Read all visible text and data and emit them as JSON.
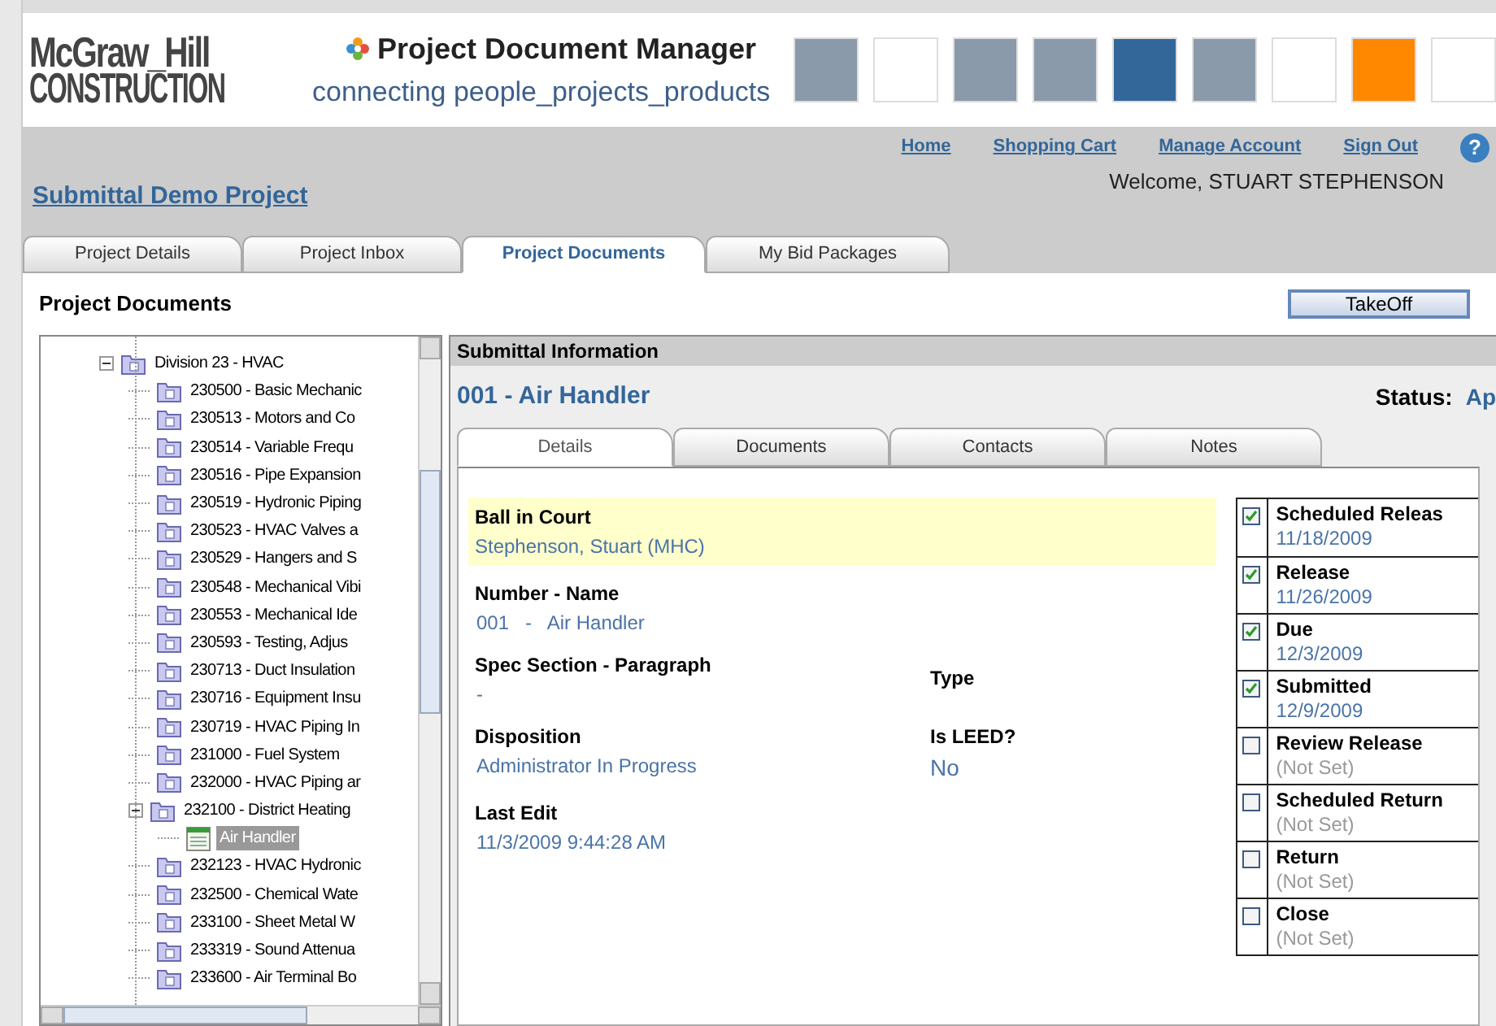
{
  "header": {
    "logo_line1": "McGraw_Hill",
    "logo_line2": "CONSTRUCTION",
    "product": "Project Document Manager",
    "tagline": "connecting people_projects_products",
    "tiles": [
      {
        "kind": "photo"
      },
      {
        "kind": "solid",
        "color": "#ffffff"
      },
      {
        "kind": "photo"
      },
      {
        "kind": "photo"
      },
      {
        "kind": "solid",
        "color": "#336699"
      },
      {
        "kind": "photo"
      },
      {
        "kind": "solid",
        "color": "#ffffff"
      },
      {
        "kind": "solid",
        "color": "#ff8800"
      },
      {
        "kind": "solid",
        "color": "#ffffff"
      }
    ]
  },
  "nav_links": [
    "Home",
    "Shopping Cart",
    "Manage Account",
    "Sign Out"
  ],
  "help": "?",
  "welcome": "Welcome, STUART STEPHENSON",
  "project_title": "Submittal Demo Project",
  "tabs": [
    {
      "label": "Project Details",
      "selected": false
    },
    {
      "label": "Project Inbox",
      "selected": false
    },
    {
      "label": "Project Documents",
      "selected": true
    },
    {
      "label": "My Bid Packages",
      "selected": false
    }
  ],
  "page_title": "Project Documents",
  "takeoff_button": "TakeOff",
  "tree": [
    {
      "label": "Division 23 - HVAC",
      "kind": "folder",
      "expanded": true,
      "selected": false,
      "children": [
        {
          "label": "230500 - Basic Mechanic",
          "kind": "folder",
          "selected": false
        },
        {
          "label": "230513 - Motors and Co",
          "kind": "folder",
          "selected": false
        },
        {
          "label": "230514 - Variable Frequ",
          "kind": "folder",
          "selected": false
        },
        {
          "label": "230516 - Pipe Expansion",
          "kind": "folder",
          "selected": false
        },
        {
          "label": "230519 - Hydronic Piping",
          "kind": "folder",
          "selected": false
        },
        {
          "label": "230523 - HVAC Valves a",
          "kind": "folder",
          "selected": false
        },
        {
          "label": "230529 - Hangers and S",
          "kind": "folder",
          "selected": false
        },
        {
          "label": "230548 - Mechanical Vibi",
          "kind": "folder",
          "selected": false
        },
        {
          "label": "230553 - Mechanical Ide",
          "kind": "folder",
          "selected": false
        },
        {
          "label": "230593 - Testing, Adjus",
          "kind": "folder",
          "selected": false
        },
        {
          "label": "230713 - Duct Insulation",
          "kind": "folder",
          "selected": false
        },
        {
          "label": "230716 - Equipment Insu",
          "kind": "folder",
          "selected": false
        },
        {
          "label": "230719 - HVAC Piping In",
          "kind": "folder",
          "selected": false
        },
        {
          "label": "231000 - Fuel System",
          "kind": "folder",
          "selected": false
        },
        {
          "label": "232000 - HVAC Piping ar",
          "kind": "folder",
          "selected": false
        },
        {
          "label": "232100 - District Heating",
          "kind": "folder",
          "expanded": true,
          "selected": false,
          "children": [
            {
              "label": "Air Handler",
              "kind": "document",
              "selected": true
            }
          ]
        },
        {
          "label": "232123 - HVAC Hydronic",
          "kind": "folder",
          "selected": false
        },
        {
          "label": "232500 - Chemical Wate",
          "kind": "folder",
          "selected": false
        },
        {
          "label": "233100 - Sheet Metal W",
          "kind": "folder",
          "selected": false
        },
        {
          "label": "233319 - Sound Attenua",
          "kind": "folder",
          "selected": false
        },
        {
          "label": "233600 - Air Terminal Bo",
          "kind": "folder",
          "selected": false
        }
      ]
    }
  ],
  "submittal": {
    "header": "Submittal Information",
    "title": "001 - Air Handler",
    "status_label": "Status:",
    "status_value": "Ap",
    "tabs": [
      {
        "label": "Details",
        "selected": true
      },
      {
        "label": "Documents",
        "selected": false
      },
      {
        "label": "Contacts",
        "selected": false
      },
      {
        "label": "Notes",
        "selected": false
      }
    ],
    "ball_in_court": {
      "label": "Ball in Court",
      "value": "Stephenson, Stuart (MHC)",
      "highlighted": true
    },
    "rows": [
      {
        "left": {
          "label": "Number - Name",
          "value": "001   -   Air Handler"
        }
      },
      {
        "left": {
          "label": "Spec Section - Paragraph",
          "value": "-"
        },
        "right": {
          "label": "Type"
        }
      },
      {
        "left": {
          "label": "Disposition",
          "value": "Administrator In Progress"
        },
        "right": {
          "label": "Is LEED?",
          "value": "No"
        }
      },
      {
        "left": {
          "label": "Last Edit",
          "value": "11/3/2009 9:44:28 AM"
        }
      }
    ],
    "milestones": [
      {
        "label": "Scheduled Releas",
        "date": "11/18/2009",
        "checked": true
      },
      {
        "label": "Release",
        "date": "11/26/2009",
        "checked": true
      },
      {
        "label": "Due",
        "date": "12/3/2009",
        "checked": true
      },
      {
        "label": "Submitted",
        "date": "12/9/2009",
        "checked": true
      },
      {
        "label": "Review Release",
        "date": "(Not Set)",
        "checked": false
      },
      {
        "label": "Scheduled Return",
        "date": "(Not Set)",
        "checked": false
      },
      {
        "label": "Return",
        "date": "(Not Set)",
        "checked": false
      },
      {
        "label": "Close",
        "date": "(Not Set)",
        "checked": false
      }
    ]
  }
}
